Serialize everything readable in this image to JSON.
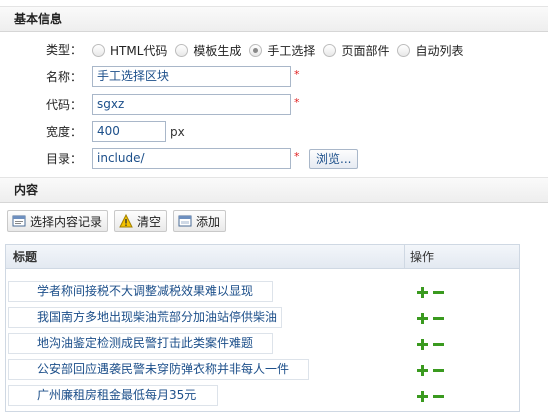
{
  "basic_section": {
    "title": "基本信息"
  },
  "type_field": {
    "label": "类型：",
    "options": [
      {
        "label": "HTML代码",
        "checked": false
      },
      {
        "label": "模板生成",
        "checked": false
      },
      {
        "label": "手工选择",
        "checked": true
      },
      {
        "label": "页面部件",
        "checked": false
      },
      {
        "label": "自动列表",
        "checked": false
      }
    ]
  },
  "name_field": {
    "label": "名称：",
    "value": "手工选择区块",
    "required_mark": "*"
  },
  "code_field": {
    "label": "代码：",
    "value": "sgxz",
    "required_mark": "*"
  },
  "width_field": {
    "label": "宽度：",
    "value": "400",
    "unit": "px"
  },
  "dir_field": {
    "label": "目录：",
    "value": "include/",
    "required_mark": "*",
    "browse_label": "浏览..."
  },
  "content_section": {
    "title": "内容"
  },
  "toolbar": {
    "select_label": "选择内容记录",
    "clear_label": "清空",
    "add_label": "添加"
  },
  "grid": {
    "header_title": "标题",
    "header_op": "操作",
    "rows": [
      "学者称间接税不大调整减税效果难以显现",
      "我国南方多地出现柴油荒部分加油站停供柴油",
      "地沟油鉴定检测成民警打击此类案件难题",
      "公安部回应遇袭民警未穿防弹衣称并非每人一件",
      "广州廉租房租金最低每月35元"
    ]
  },
  "colors": {
    "plus": "#3a9a1f",
    "minus": "#3a9a1f",
    "link": "#1c4f8a",
    "required": "#e02020"
  }
}
